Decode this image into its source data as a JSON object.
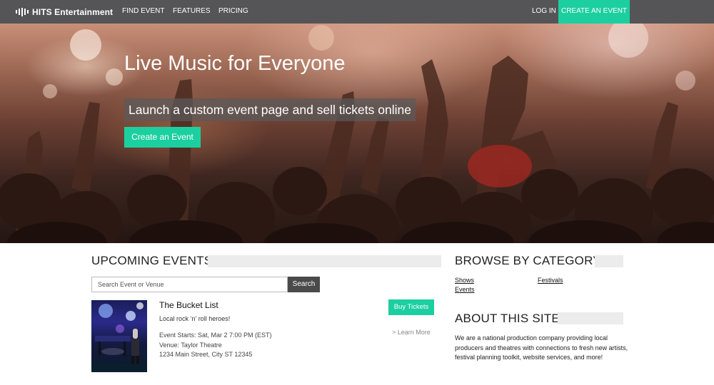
{
  "nav": {
    "brand": "HITS Entertainment",
    "links": [
      "FIND EVENT",
      "FEATURES",
      "PRICING"
    ],
    "login": "LOG IN",
    "create": "CREATE AN EVENT"
  },
  "hero": {
    "title": "Live Music for Everyone",
    "subtitle": "Launch a custom event page and sell tickets online",
    "cta": "Create an Event"
  },
  "upcoming": {
    "title": "UPCOMING EVENTS",
    "search": {
      "placeholder": "Search Event or Venue",
      "button": "Search"
    },
    "events": [
      {
        "name": "The Bucket List",
        "tagline": "Local rock ‘n’ roll heroes!",
        "starts": "Event Starts: Sat, Mar 2 7:00 PM (EST)",
        "venue": "Venue: Taylor Theatre",
        "address": "1234 Main Street, City ST 12345",
        "buy": "Buy Tickets",
        "more": "> Learn More"
      }
    ]
  },
  "browse": {
    "title": "BROWSE BY CATEGORY",
    "categories": [
      "Shows",
      "Festivals",
      "Events"
    ]
  },
  "about": {
    "title": "ABOUT THIS SITE",
    "text": "We are a national production company providing local producers and theatres with connections to fresh new artists, festival planning toolkit, website services, and more!"
  },
  "colors": {
    "accent": "#1ccfa0",
    "nav_bg": "#555557",
    "search_btn": "#4a4a4a"
  }
}
